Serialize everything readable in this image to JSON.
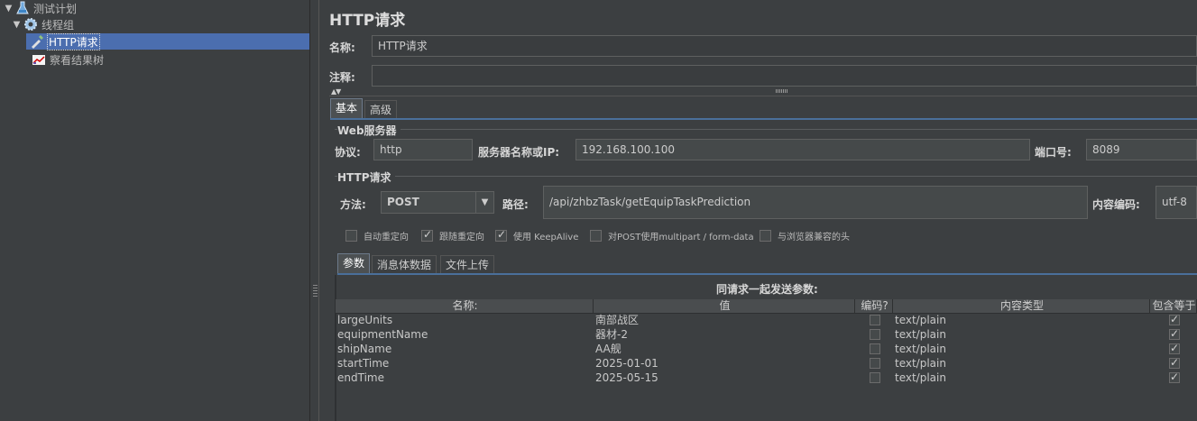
{
  "tree": {
    "items": [
      {
        "label": "测试计划",
        "icon": "flask-icon",
        "expanded": true
      },
      {
        "label": "线程组",
        "icon": "gear-icon",
        "expanded": true
      },
      {
        "label": "HTTP请求",
        "icon": "pipette-icon",
        "selected": true
      },
      {
        "label": "察看结果树",
        "icon": "chart-icon"
      }
    ]
  },
  "panel": {
    "title": "HTTP请求",
    "name_label": "名称:",
    "name_value": "HTTP请求",
    "comment_label": "注释:",
    "comment_value": ""
  },
  "tabs": {
    "basic": "基本",
    "advanced": "高级"
  },
  "web_server": {
    "title": "Web服务器",
    "protocol_label": "协议:",
    "protocol_value": "http",
    "server_label": "服务器名称或IP:",
    "server_value": "192.168.100.100",
    "port_label": "端口号:",
    "port_value": "8089"
  },
  "http_request": {
    "title": "HTTP请求",
    "method_label": "方法:",
    "method_value": "POST",
    "path_label": "路径:",
    "path_value": "/api/zhbzTask/getEquipTaskPrediction",
    "encoding_label": "内容编码:",
    "encoding_value": "utf-8"
  },
  "options": [
    {
      "label": "自动重定向",
      "checked": false
    },
    {
      "label": "跟随重定向",
      "checked": true
    },
    {
      "label": "使用 KeepAlive",
      "checked": true
    },
    {
      "label": "对POST使用multipart / form-data",
      "checked": false
    },
    {
      "label": "与浏览器兼容的头",
      "checked": false
    }
  ],
  "subtabs": {
    "params": "参数",
    "body": "消息体数据",
    "files": "文件上传"
  },
  "params_table": {
    "caption": "同请求一起发送参数:",
    "headers": [
      "名称:",
      "值",
      "编码?",
      "内容类型",
      "包含等于"
    ],
    "rows": [
      {
        "name": "largeUnits",
        "value": "南部战区",
        "encode": false,
        "content_type": "text/plain",
        "include_equals": true
      },
      {
        "name": "equipmentName",
        "value": "器材-2",
        "encode": false,
        "content_type": "text/plain",
        "include_equals": true
      },
      {
        "name": "shipName",
        "value": "AA舰",
        "encode": false,
        "content_type": "text/plain",
        "include_equals": true
      },
      {
        "name": "startTime",
        "value": "2025-01-01",
        "encode": false,
        "content_type": "text/plain",
        "include_equals": true
      },
      {
        "name": "endTime",
        "value": "2025-05-15",
        "encode": false,
        "content_type": "text/plain",
        "include_equals": true
      }
    ]
  }
}
